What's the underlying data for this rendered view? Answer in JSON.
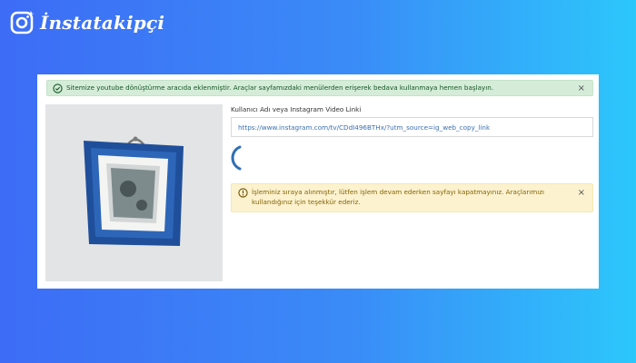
{
  "brand": {
    "name": "İnstatakipçi"
  },
  "alerts": {
    "success": {
      "text": "Sitemize youtube dönüştürme aracıda eklenmiştir. Araçlar sayfamızdaki menülerden erişerek bedava kullanmaya hemen başlayın.",
      "close": "×"
    },
    "warning": {
      "text": "İşleminiz sıraya alınmıştır, lütfen işlem devam ederken sayfayı kapatmayınız. Araçlarımızı kullandığınız için teşekkür ederiz.",
      "close": "×"
    }
  },
  "form": {
    "label": "Kullanıcı Adı veya Instagram Video Linki",
    "url_value": "https://www.instagram.com/tv/CDdI496BTHx/?utm_source=ig_web_copy_link"
  },
  "colors": {
    "success_bg": "#d4ecd8",
    "warning_bg": "#fcf2cf",
    "spinner": "#2f6fb5",
    "frame_blue": "#2a5fae"
  },
  "icons": {
    "logo": "instagram-camera-icon",
    "success": "check-circle-icon",
    "warning": "exclamation-circle-icon",
    "loading": "loading-spinner-icon",
    "placeholder": "picture-frame-icon"
  }
}
